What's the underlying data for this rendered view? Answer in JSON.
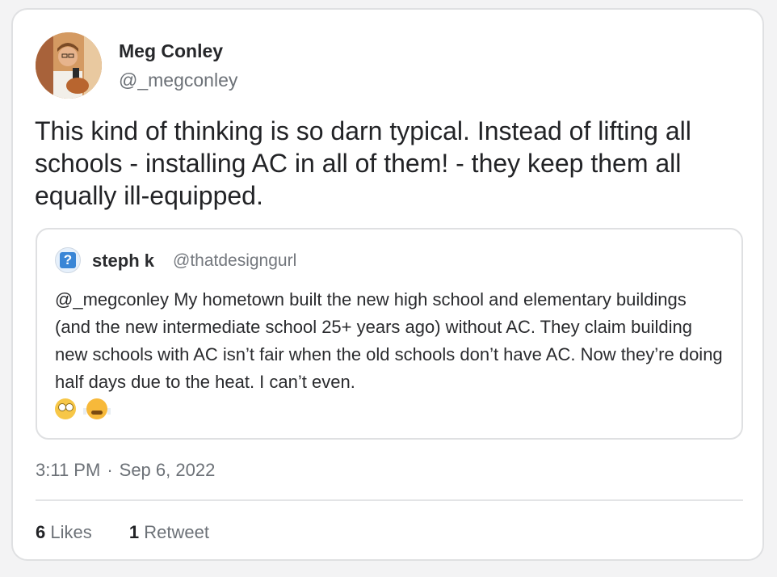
{
  "author": {
    "name": "Meg Conley",
    "handle": "@_megconley"
  },
  "tweet_text": "This kind of thinking is so darn typical. Instead of lifting all schools - installing AC in all of them! - they keep them all equally ill-equipped.",
  "quoted_tweet": {
    "name": "steph k",
    "handle": "@thatdesigngurl",
    "avatar_glyph": "?",
    "text": "@_megconley My hometown built the new high school and elementary buildings  (and the new intermediate school 25+ years ago) without AC. They claim building new schools with AC isn’t fair when the old schools don’t have AC. Now they’re doing half days due to the heat. I can’t even.",
    "emojis": [
      "face-with-rolling-eyes-icon",
      "face-with-steam-icon"
    ]
  },
  "timestamp": {
    "time": "3:11 PM",
    "separator": "·",
    "date": "Sep 6, 2022"
  },
  "stats": {
    "likes_count": "6",
    "likes_label": "Likes",
    "retweets_count": "1",
    "retweets_label": "Retweet"
  }
}
